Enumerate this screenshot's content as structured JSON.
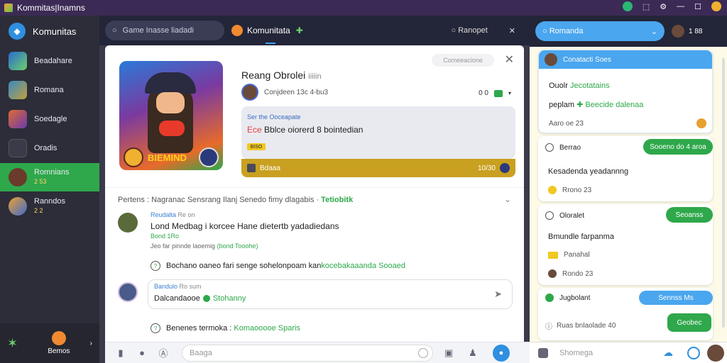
{
  "window": {
    "title": "Kommitas|Inamns"
  },
  "sidebar": {
    "header": "Komunitas",
    "items": [
      {
        "label": "Beadahare",
        "sub": ""
      },
      {
        "label": "Romana",
        "sub": ""
      },
      {
        "label": "Soedagle",
        "sub": ""
      },
      {
        "label": "Oradis",
        "sub": ""
      },
      {
        "label": "Romnians",
        "sub": "2 53"
      },
      {
        "label": "Ranndos",
        "sub": "2 2"
      }
    ],
    "bottom_label": "Bemos"
  },
  "topbar": {
    "search_placeholder": "Game Inasse liadadi",
    "channel": "Komunitata",
    "right_label": "Ranopet"
  },
  "post": {
    "badge": "Comeeacione",
    "title": "Reang Obrolei",
    "title_small": "iiiiin",
    "author": "Conjdeen 13c 4-bu3",
    "counts": "0   0",
    "quote_label": "Ser the Ooceapate",
    "quote_red": "Ece",
    "quote_text": "Bblce oiorerd 8 bointedian",
    "quote_tag": "BISO",
    "bar_left": "Bdaaa",
    "bar_right": "10/30",
    "art_text": "BIEMIND"
  },
  "thread": {
    "filter_text": "Pertens :  Nagranac Sensrang Ilanj Senedo fimy dlagabis  ·",
    "filter_green": "Tetiobitk",
    "comment": {
      "name": "Reudalta",
      "time": "Re on",
      "text": "Lond  Medbag i korcee Hane dietertb yadadiedans",
      "small": "Bond 1Ro",
      "meta": "Jeo far pinnde laoemig",
      "meta_green": "(bond Tooohe)"
    },
    "info1": "Bochano oaneo fari senge sohelonpoam  kan",
    "info1_green": "kocebakaaanda Sooaed",
    "reply": {
      "name": "Bandulo",
      "time": "Ro sum",
      "text": "Dalcandaooe",
      "text_green": "Stohanny"
    },
    "info2": "Benenes termoka :",
    "info2_green": "Komaooooe Sparis"
  },
  "composer": {
    "placeholder": "Baaga"
  },
  "right": {
    "search": "Romanda",
    "counter": "1 88",
    "card1": {
      "header": "Conatacti Soes",
      "l1": "Ouolr",
      "l1_green": "Jecotatains",
      "l2": "peplam",
      "l2_green": "✚ Beecide dalenaa",
      "l3": "Aaro oe 23"
    },
    "card2": {
      "header": "Berrao",
      "pill": "Sooeno do 4 aroa",
      "l1": "Kesadenda yeadannng",
      "l2": "Rrono 23"
    },
    "card3": {
      "header": "Oloralet",
      "pill": "Seoanss",
      "l1": "Bmundle  farpanma",
      "l2": "Panahal",
      "l3": "Rondo 23"
    },
    "card4": {
      "header": "Jugbolant",
      "pill1": "Sennss Ms",
      "l1": "Ruas bnlaolade 40",
      "pill2": "Geobec"
    },
    "composer_placeholder": "Shomega"
  }
}
